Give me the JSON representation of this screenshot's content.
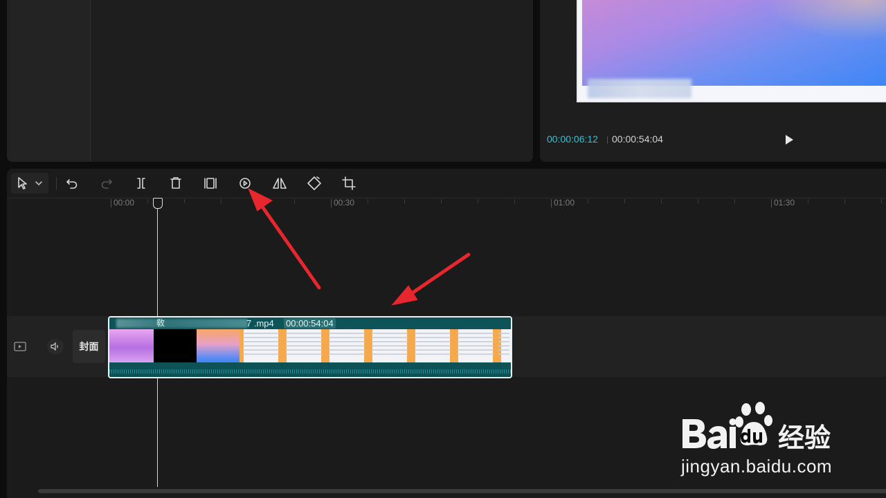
{
  "player": {
    "current_time": "00:00:06:12",
    "separator": "|",
    "total_time": "00:00:54:04"
  },
  "toolbar": {
    "items": [
      {
        "icon": "select-pointer-icon",
        "enabled": true
      },
      {
        "icon": "undo-icon",
        "enabled": true
      },
      {
        "icon": "redo-icon",
        "enabled": false
      },
      {
        "icon": "split-icon",
        "enabled": true
      },
      {
        "icon": "delete-icon",
        "enabled": true
      },
      {
        "icon": "freeze-frame-icon",
        "enabled": true
      },
      {
        "icon": "reverse-icon",
        "enabled": true
      },
      {
        "icon": "mirror-icon",
        "enabled": true
      },
      {
        "icon": "rotate-icon",
        "enabled": true
      },
      {
        "icon": "crop-icon",
        "enabled": true
      }
    ]
  },
  "ruler": {
    "labels": [
      "00:00",
      "00:30",
      "01:00",
      "01:30"
    ]
  },
  "track": {
    "cover_label": "封面"
  },
  "clip": {
    "name_fragment": "敎",
    "filename_suffix": "7 .mp4",
    "duration": "00:00:54:04"
  },
  "watermark": {
    "brand": "Bai",
    "brand_suffix": "du",
    "product": "经验",
    "url": "jingyan.baidu.com"
  },
  "colors": {
    "accent_time": "#2ec6d6",
    "clip_track": "#0e5358",
    "annotation": "#e8262d"
  }
}
